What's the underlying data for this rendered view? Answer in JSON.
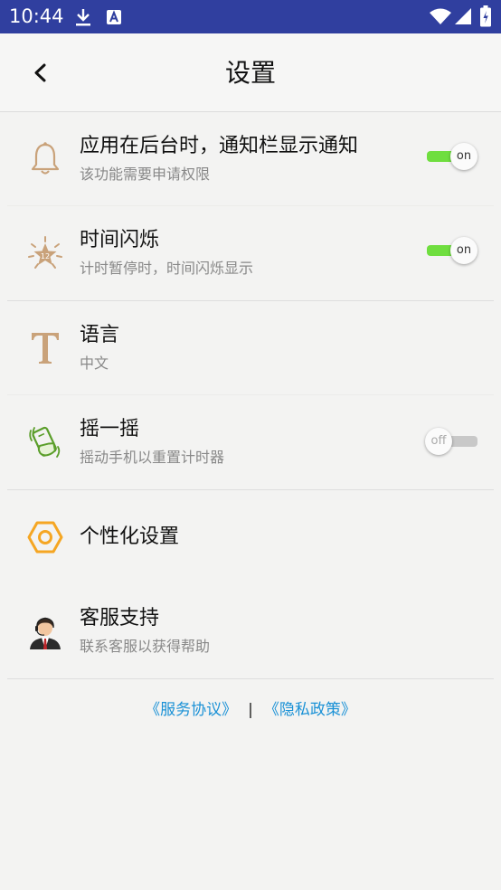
{
  "status_bar": {
    "time": "10:44",
    "icons": [
      "download-icon",
      "a-badge-icon",
      "wifi-icon",
      "signal-icon",
      "battery-icon"
    ]
  },
  "header": {
    "title": "设置",
    "back_icon": "chevron-left-icon"
  },
  "settings": [
    {
      "icon": "bell-icon",
      "title": "应用在后台时，通知栏显示通知",
      "subtitle": "该功能需要申请权限",
      "toggle": true,
      "toggle_label": "on"
    },
    {
      "icon": "star-burst-icon",
      "title": "时间闪烁",
      "subtitle": "计时暂停时，时间闪烁显示",
      "toggle": true,
      "toggle_label": "on"
    },
    {
      "icon": "language-t-icon",
      "title": "语言",
      "subtitle": "中文"
    },
    {
      "icon": "shake-phone-icon",
      "title": "摇一摇",
      "subtitle": "摇动手机以重置计时器",
      "toggle": false,
      "toggle_label": "off"
    },
    {
      "icon": "hexagon-nut-icon",
      "title": "个性化设置"
    },
    {
      "icon": "support-agent-icon",
      "title": "客服支持",
      "subtitle": "联系客服以获得帮助"
    }
  ],
  "footer": {
    "service_agreement": "《服务协议》",
    "separator": "|",
    "privacy_policy": "《隐私政策》"
  },
  "colors": {
    "status_bar": "#303f9f",
    "toggle_on": "#6fde3f",
    "toggle_off": "#c8c8c8",
    "link": "#1a91d6",
    "icon_tan": "#c9a27a",
    "icon_orange": "#f5a623",
    "icon_green": "#5a9e2a"
  }
}
